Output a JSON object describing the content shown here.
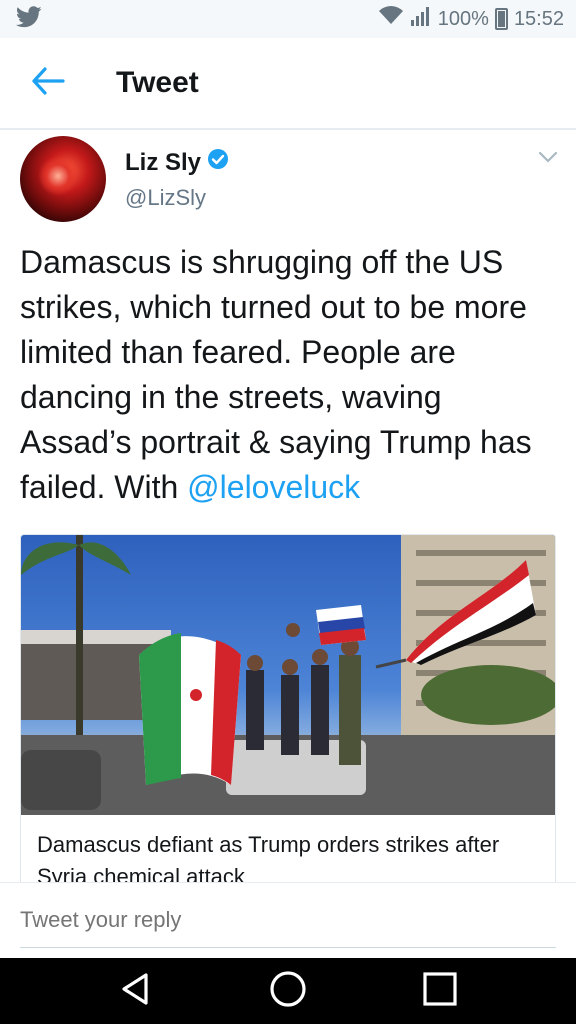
{
  "status_bar": {
    "app_icon": "twitter-bird-icon",
    "battery_percent": "100%",
    "time": "15:52"
  },
  "header": {
    "title": "Tweet",
    "back_icon": "back-arrow-icon"
  },
  "tweet": {
    "author_name": "Liz Sly",
    "author_handle": "@LizSly",
    "verified": true,
    "text_before_mention": "Damascus is shrugging off the US strikes, which turned out to be more limited than feared. People are dancing in the streets, waving Assad’s portrait & saying Trump has failed. With ",
    "mention": "@leloveluck"
  },
  "card": {
    "title": "Damascus defiant as Trump orders strikes after Syria chemical attack"
  },
  "reply": {
    "placeholder": "Tweet your reply"
  },
  "nav": {
    "back": "nav-back-icon",
    "home": "nav-home-icon",
    "recents": "nav-recents-icon"
  },
  "colors": {
    "accent": "#1da1f2",
    "status_bar_bg": "#f5f8fa"
  }
}
